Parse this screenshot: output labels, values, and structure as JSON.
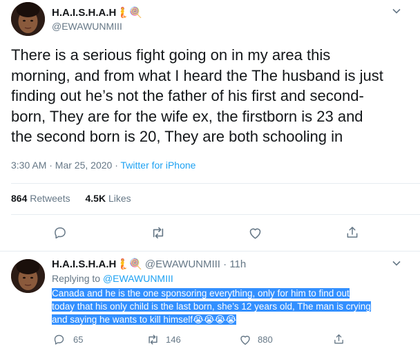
{
  "main_tweet": {
    "display_name": "H.A.I.S.H.A.H",
    "name_emojis": "🧜🍭",
    "handle": "@EWAWUNMIII",
    "text_lines": [
      "There is a serious fight going on in my area this",
      "morning, and from what I heard the The husband is just",
      "finding out he’s not the father of his first and second-",
      "born, They are for  the wife ex, the firstborn is 23 and",
      "the second born is 20, They are both schooling in"
    ],
    "time": "3:30 AM · Mar 25, 2020",
    "separator": " · ",
    "source": "Twitter for iPhone",
    "retweets_count": "864",
    "retweets_label": "Retweets",
    "likes_count": "4.5K",
    "likes_label": "Likes"
  },
  "reply_tweet": {
    "display_name": "H.A.I.S.H.A.H",
    "name_emojis": "🧜🍭",
    "handle": "@EWAWUNMIII",
    "time_ago": "· 11h",
    "replying_to_label": "Replying to ",
    "replying_to_handle": "@EWAWUNMIII",
    "text_lines": [
      "Canada and he is the one sponsoring everything, only for him to find out",
      "today that his only child is the last born, she’s 12 years old, The man is crying",
      "and saying he wants to kill himself"
    ],
    "text_emojis": "😭😭😭😭",
    "reply_count": "65",
    "retweet_count": "146",
    "like_count": "880"
  },
  "colors": {
    "accent": "#1da1f2",
    "muted": "#657786",
    "text": "#14171a",
    "divider": "#e6ecf0",
    "selection": "#3390ff"
  },
  "icons": [
    "avatar",
    "chevron-down-icon",
    "reply-icon",
    "retweet-icon",
    "like-icon",
    "share-icon"
  ]
}
